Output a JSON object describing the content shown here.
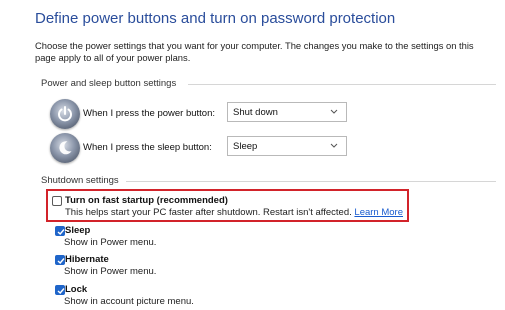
{
  "page_title": "Define power buttons and turn on password protection",
  "intro": "Choose the power settings that you want for your computer. The changes you make to the settings on this page apply to all of your power plans.",
  "power_group": {
    "heading": "Power and sleep button settings",
    "rows": [
      {
        "label": "When I press the power button:",
        "value": "Shut down",
        "icon": "power-button-icon"
      },
      {
        "label": "When I press the sleep button:",
        "value": "Sleep",
        "icon": "sleep-button-icon"
      }
    ]
  },
  "shutdown_group": {
    "heading": "Shutdown settings",
    "fast_startup": {
      "title": "Turn on fast startup (recommended)",
      "desc": "This helps start your PC faster after shutdown. Restart isn't affected.",
      "link": "Learn More",
      "checked": false
    },
    "options": [
      {
        "title": "Sleep",
        "desc": "Show in Power menu.",
        "checked": true
      },
      {
        "title": "Hibernate",
        "desc": "Show in Power menu.",
        "checked": true
      },
      {
        "title": "Lock",
        "desc": "Show in account picture menu.",
        "checked": true
      }
    ]
  },
  "colors": {
    "accent": "#1f65c9",
    "title": "#2a4d9b",
    "highlight": "#d2232a"
  }
}
